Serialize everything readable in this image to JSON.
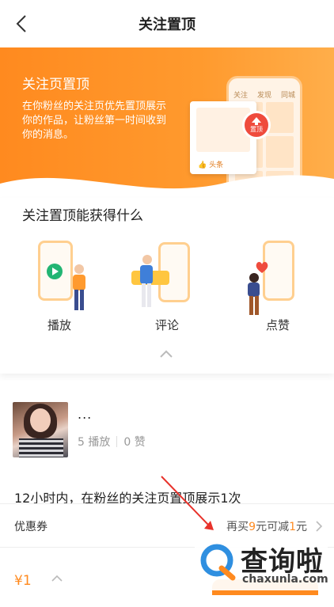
{
  "nav": {
    "title": "关注置顶"
  },
  "banner": {
    "title": "关注页置顶",
    "description": "在你粉丝的关注页优先置顶展示你的作品，让粉丝第一时间收到你的消息。",
    "phone_tabs": [
      "关注",
      "发现",
      "同城"
    ],
    "pin_label": "置顶",
    "card_tag": "头条"
  },
  "benefits": {
    "heading": "关注置顶能获得什么",
    "items": [
      {
        "label": "播放"
      },
      {
        "label": "评论"
      },
      {
        "label": "点赞"
      }
    ]
  },
  "video": {
    "title": "...",
    "plays": "5 播放",
    "likes": "0 赞"
  },
  "info_text": "12小时内，在粉丝的关注页置顶展示1次",
  "coupon": {
    "label": "优惠券",
    "offer_prefix": "再买",
    "offer_amount": "9",
    "offer_mid": "元可减",
    "offer_discount": "1",
    "offer_suffix": "元"
  },
  "bottom": {
    "price": "¥1"
  },
  "watermark": {
    "cn": "查询啦",
    "en": "chaxunla.com"
  },
  "colors": {
    "accent": "#ff8a1f",
    "pin": "#ef4b3d"
  }
}
